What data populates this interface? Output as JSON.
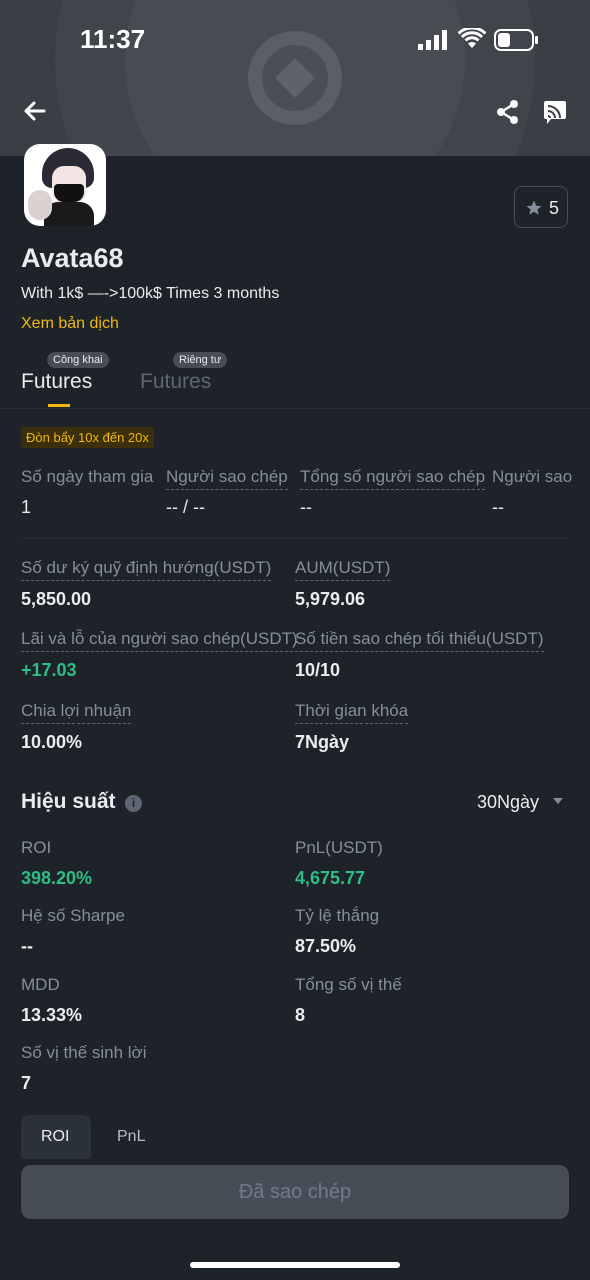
{
  "status_bar": {
    "time": "11:37"
  },
  "profile": {
    "name": "Avata68",
    "bio": "With 1k$ —->100k$ Times 3 months",
    "translate_link": "Xem bản dịch",
    "favorites_count": "5"
  },
  "tabs": [
    {
      "label": "Futures",
      "badge": "Công khai",
      "active": true
    },
    {
      "label": "Futures",
      "badge": "Riêng tư",
      "active": false
    }
  ],
  "leverage_tag": "Đòn bẩy 10x đến 20x",
  "stats_row": [
    {
      "label": "Số ngày tham gia",
      "value": "1"
    },
    {
      "label": "Người sao chép",
      "value": "-- / --"
    },
    {
      "label": "Tổng số người sao chép",
      "value": "--"
    },
    {
      "label": "Người sao",
      "value": "--"
    }
  ],
  "details": {
    "margin_label": "Số dư ký quỹ định hướng(USDT)",
    "margin_value": "5,850.00",
    "aum_label": "AUM(USDT)",
    "aum_value": "5,979.06",
    "copier_pnl_label": "Lãi và lỗ của người sao chép(USDT)",
    "copier_pnl_value": "+17.03",
    "min_copy_label": "Số tiền sao chép tối thiểu(USDT)",
    "min_copy_value": "10/10",
    "profit_share_label": "Chia lợi nhuận",
    "profit_share_value": "10.00%",
    "lock_label": "Thời gian khóa",
    "lock_value": "7Ngày"
  },
  "performance": {
    "title": "Hiệu suất",
    "period": "30Ngày",
    "roi_label": "ROI",
    "roi_value": "398.20%",
    "pnl_label": "PnL(USDT)",
    "pnl_value": "4,675.77",
    "sharpe_label": "Hệ số Sharpe",
    "sharpe_value": "--",
    "winrate_label": "Tỷ lệ thắng",
    "winrate_value": "87.50%",
    "mdd_label": "MDD",
    "mdd_value": "13.33%",
    "positions_label": "Tổng số vị thế",
    "positions_value": "8",
    "profitable_label": "Số vị thế sinh lời",
    "profitable_value": "7"
  },
  "chart_tabs": [
    "ROI",
    "PnL"
  ],
  "copy_button": "Đã sao chép",
  "colors": {
    "accent": "#f0b90b",
    "positive": "#2ebd85",
    "background": "#1e2329"
  }
}
